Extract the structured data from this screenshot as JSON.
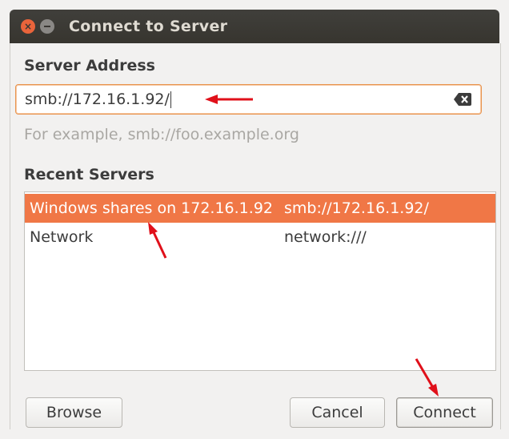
{
  "window": {
    "title": "Connect to Server"
  },
  "server_address": {
    "label": "Server Address",
    "value": "smb://172.16.1.92/",
    "hint": "For example, smb://foo.example.org"
  },
  "recent_servers": {
    "label": "Recent Servers",
    "rows": [
      {
        "name": "Windows shares on 172.16.1.92",
        "url": "smb://172.16.1.92/",
        "selected": true
      },
      {
        "name": "Network",
        "url": "network:///",
        "selected": false
      }
    ]
  },
  "buttons": {
    "browse": "Browse",
    "cancel": "Cancel",
    "connect": "Connect"
  },
  "colors": {
    "accent": "#f07746",
    "annotation_arrow": "#e0101a",
    "titlebar": "#3c3b37"
  },
  "icons": {
    "close": "close-icon",
    "minimize": "minimize-icon",
    "clear": "clear-text-icon"
  }
}
